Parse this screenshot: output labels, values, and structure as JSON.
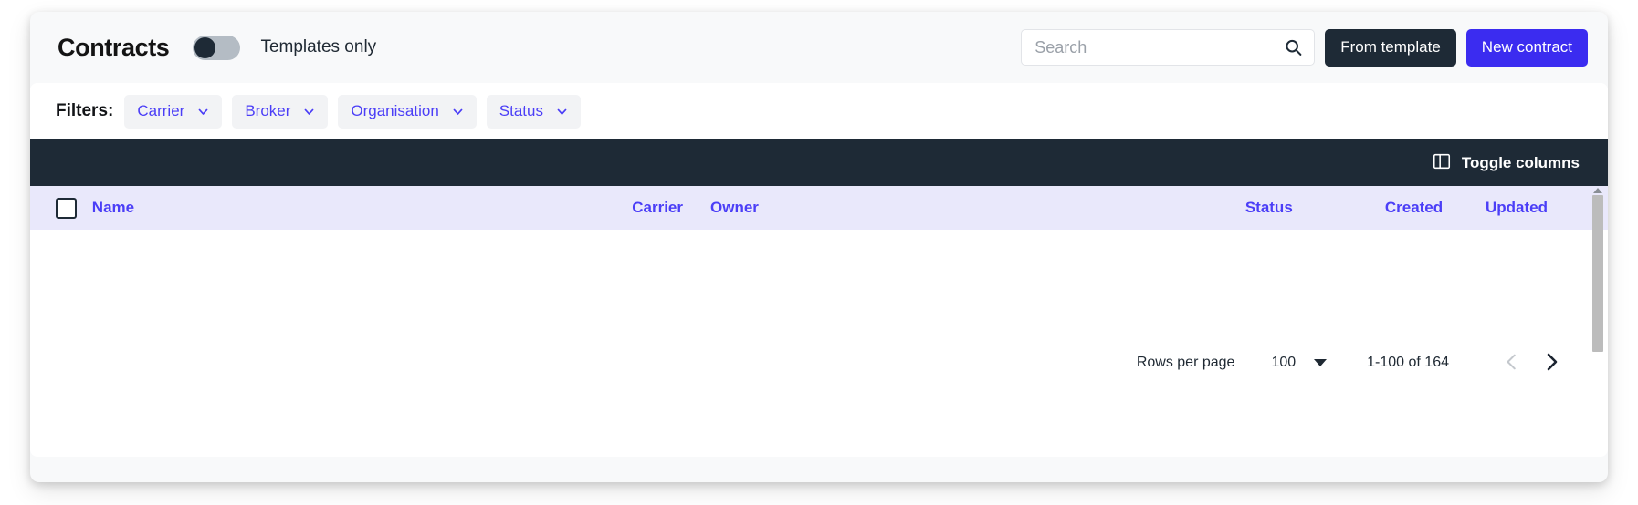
{
  "header": {
    "title": "Contracts",
    "toggle": {
      "name": "templates-only-toggle",
      "state": "off",
      "label": "Templates only"
    },
    "search": {
      "value": "",
      "placeholder": "Search",
      "icon": "search-icon"
    },
    "buttons": [
      {
        "label": "From template",
        "style": "dark",
        "color": "#1e2a36"
      },
      {
        "label": "New contract",
        "style": "primary",
        "color": "#3b2cf0"
      }
    ]
  },
  "filters": {
    "label": "Filters:",
    "chips": [
      {
        "label": "Carrier",
        "icon": "chevron-down-icon"
      },
      {
        "label": "Broker",
        "icon": "chevron-down-icon"
      },
      {
        "label": "Organisation",
        "icon": "chevron-down-icon"
      },
      {
        "label": "Status",
        "icon": "chevron-down-icon"
      }
    ]
  },
  "toolbar": {
    "toggle_columns_label": "Toggle columns",
    "toggle_columns_icon": "columns-icon"
  },
  "table": {
    "select_all_checkbox": {
      "icon": "checkbox-unchecked-icon",
      "checked": false
    },
    "columns": [
      "Name",
      "Carrier",
      "Owner",
      "Status",
      "Created",
      "Updated"
    ],
    "rows": [],
    "header_background": "#e9e8fb",
    "header_text_color": "#4b3ef7"
  },
  "pagination": {
    "rows_per_page_label": "Rows per page",
    "rows_per_page_value": "100",
    "rows_per_page_icon": "caret-down-icon",
    "range_label": "1-100 of 164",
    "prev": {
      "icon": "chevron-left-icon",
      "enabled": false
    },
    "next": {
      "icon": "chevron-right-icon",
      "enabled": true
    }
  },
  "scrollbar": {
    "up_arrow_icon": "scroll-up-arrow-icon",
    "thumb": "scroll-thumb"
  }
}
